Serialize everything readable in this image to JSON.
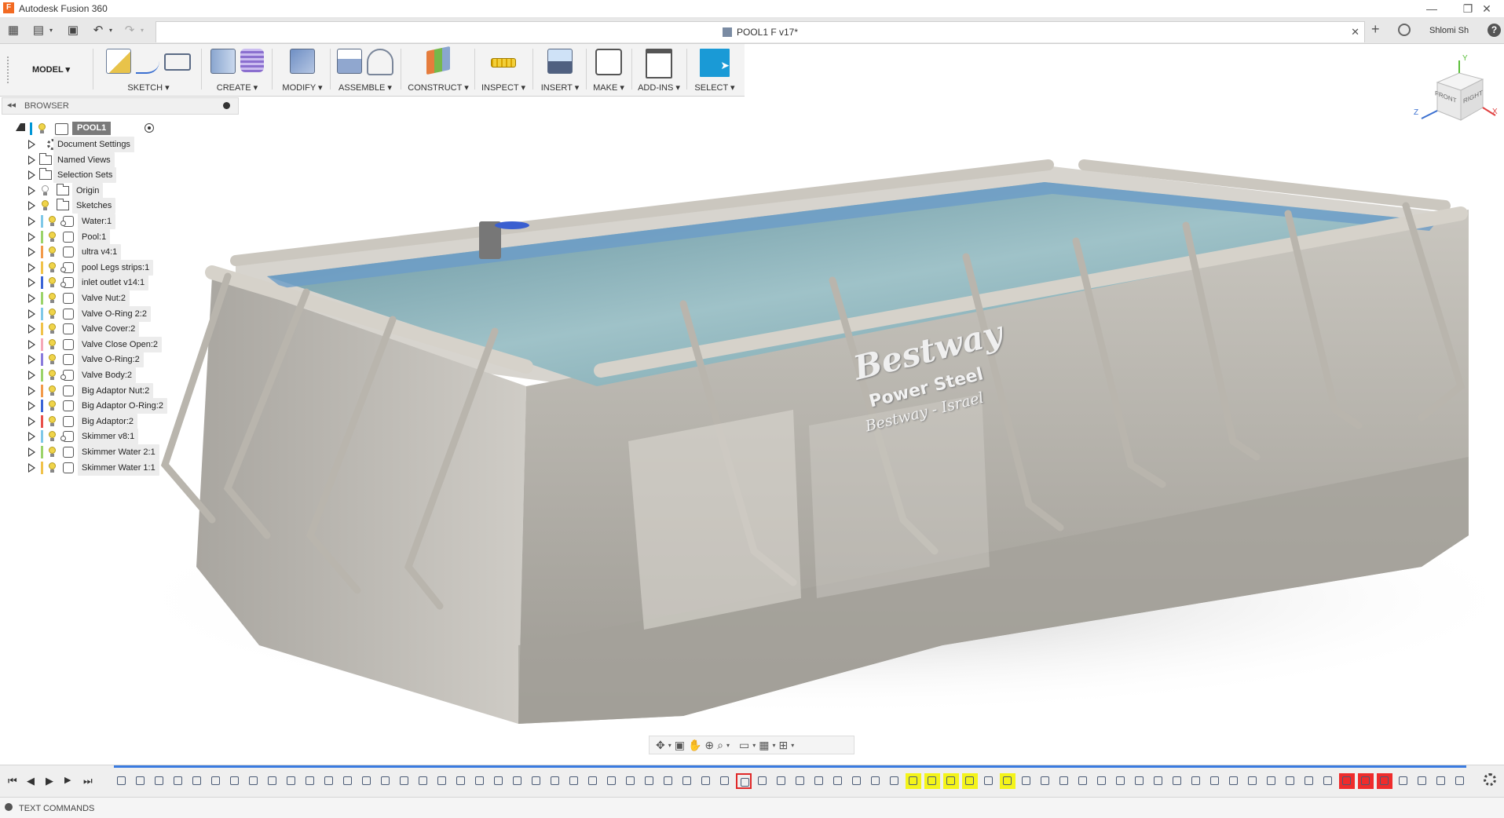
{
  "app": {
    "title": "Autodesk Fusion 360",
    "logo": "F"
  },
  "window_controls": {
    "minimize": "—",
    "restore": "❐",
    "close": "✕"
  },
  "quick_access": {
    "grid_icon": "▦",
    "file_icon": "▤",
    "save_icon": "▣",
    "undo_icon": "↶",
    "redo_icon": "↷"
  },
  "document": {
    "tab_title": "POOL1 F v17*",
    "close": "✕",
    "new_tab": "+"
  },
  "user": {
    "name": "Shlomi Sh",
    "help": "?"
  },
  "toolbar": {
    "workspace": "MODEL ▾",
    "groups": [
      {
        "label": "SKETCH ▾"
      },
      {
        "label": "CREATE ▾"
      },
      {
        "label": "MODIFY ▾"
      },
      {
        "label": "ASSEMBLE ▾"
      },
      {
        "label": "CONSTRUCT ▾"
      },
      {
        "label": "INSPECT ▾"
      },
      {
        "label": "INSERT ▾"
      },
      {
        "label": "MAKE ▾"
      },
      {
        "label": "ADD-INS ▾"
      },
      {
        "label": "SELECT ▾"
      }
    ]
  },
  "browser": {
    "collapse": "◂◂",
    "title": "BROWSER",
    "root": "POOL1 F v17",
    "items": [
      {
        "label": "Document Settings",
        "icon": "gear-icon",
        "bar": ""
      },
      {
        "label": "Named Views",
        "icon": "folder-icon",
        "bar": ""
      },
      {
        "label": "Selection Sets",
        "icon": "folder-icon",
        "bar": ""
      },
      {
        "label": "Origin",
        "icon": "folder-icon",
        "bar": "",
        "bulb": "off"
      },
      {
        "label": "Sketches",
        "icon": "folder-icon",
        "bar": "",
        "bulb": "on"
      },
      {
        "label": "Water:1",
        "icon": "component-link-icon",
        "bar": "#7fc8e8"
      },
      {
        "label": "Pool:1",
        "icon": "component-icon",
        "bar": "#9bd36a"
      },
      {
        "label": "ultra v4:1",
        "icon": "component-icon",
        "bar": "#f29a4a"
      },
      {
        "label": "pool Legs strips:1",
        "icon": "component-link-icon",
        "bar": "#f0c24a"
      },
      {
        "label": "inlet outlet v14:1",
        "icon": "component-link-icon",
        "bar": "#3b64d6"
      },
      {
        "label": "Valve Nut:2",
        "icon": "component-icon",
        "bar": "#9bd36a"
      },
      {
        "label": "Valve O-Ring 2:2",
        "icon": "component-icon",
        "bar": "#7fc8e8"
      },
      {
        "label": "Valve Cover:2",
        "icon": "component-icon",
        "bar": "#f0c24a"
      },
      {
        "label": "Valve Close Open:2",
        "icon": "component-icon",
        "bar": "#f5a8b8"
      },
      {
        "label": "Valve O-Ring:2",
        "icon": "component-icon",
        "bar": "#8a7bdc"
      },
      {
        "label": "Valve Body:2",
        "icon": "component-link-icon",
        "bar": "#9bd36a"
      },
      {
        "label": "Big Adaptor Nut:2",
        "icon": "component-icon",
        "bar": "#f29a4a"
      },
      {
        "label": "Big Adaptor O-Ring:2",
        "icon": "component-icon",
        "bar": "#3b64d6"
      },
      {
        "label": "Big Adaptor:2",
        "icon": "component-icon",
        "bar": "#e8504a"
      },
      {
        "label": "Skimmer v8:1",
        "icon": "component-link-icon",
        "bar": "#7fc8e8"
      },
      {
        "label": "Skimmer Water 2:1",
        "icon": "component-icon",
        "bar": "#9bd36a"
      },
      {
        "label": "Skimmer Water 1:1",
        "icon": "component-icon",
        "bar": "#f0c24a"
      }
    ]
  },
  "viewcube": {
    "front": "FRONT",
    "right": "RIGHT",
    "axis_z": "Z",
    "axis_x": "X",
    "axis_y": "Y"
  },
  "model": {
    "brand": "Bestway",
    "line1": "Power Steel",
    "line2": "Bestway - Israel"
  },
  "timeline": {
    "controls": [
      "⏮",
      "◀",
      "▶",
      "▶",
      "⏭"
    ],
    "highlight_yellow": [
      42,
      43,
      44,
      45,
      47
    ],
    "highlight_red": [
      65,
      66,
      67
    ],
    "highlight_red_outline": [
      33
    ]
  },
  "text_commands": {
    "label": "TEXT COMMANDS"
  }
}
